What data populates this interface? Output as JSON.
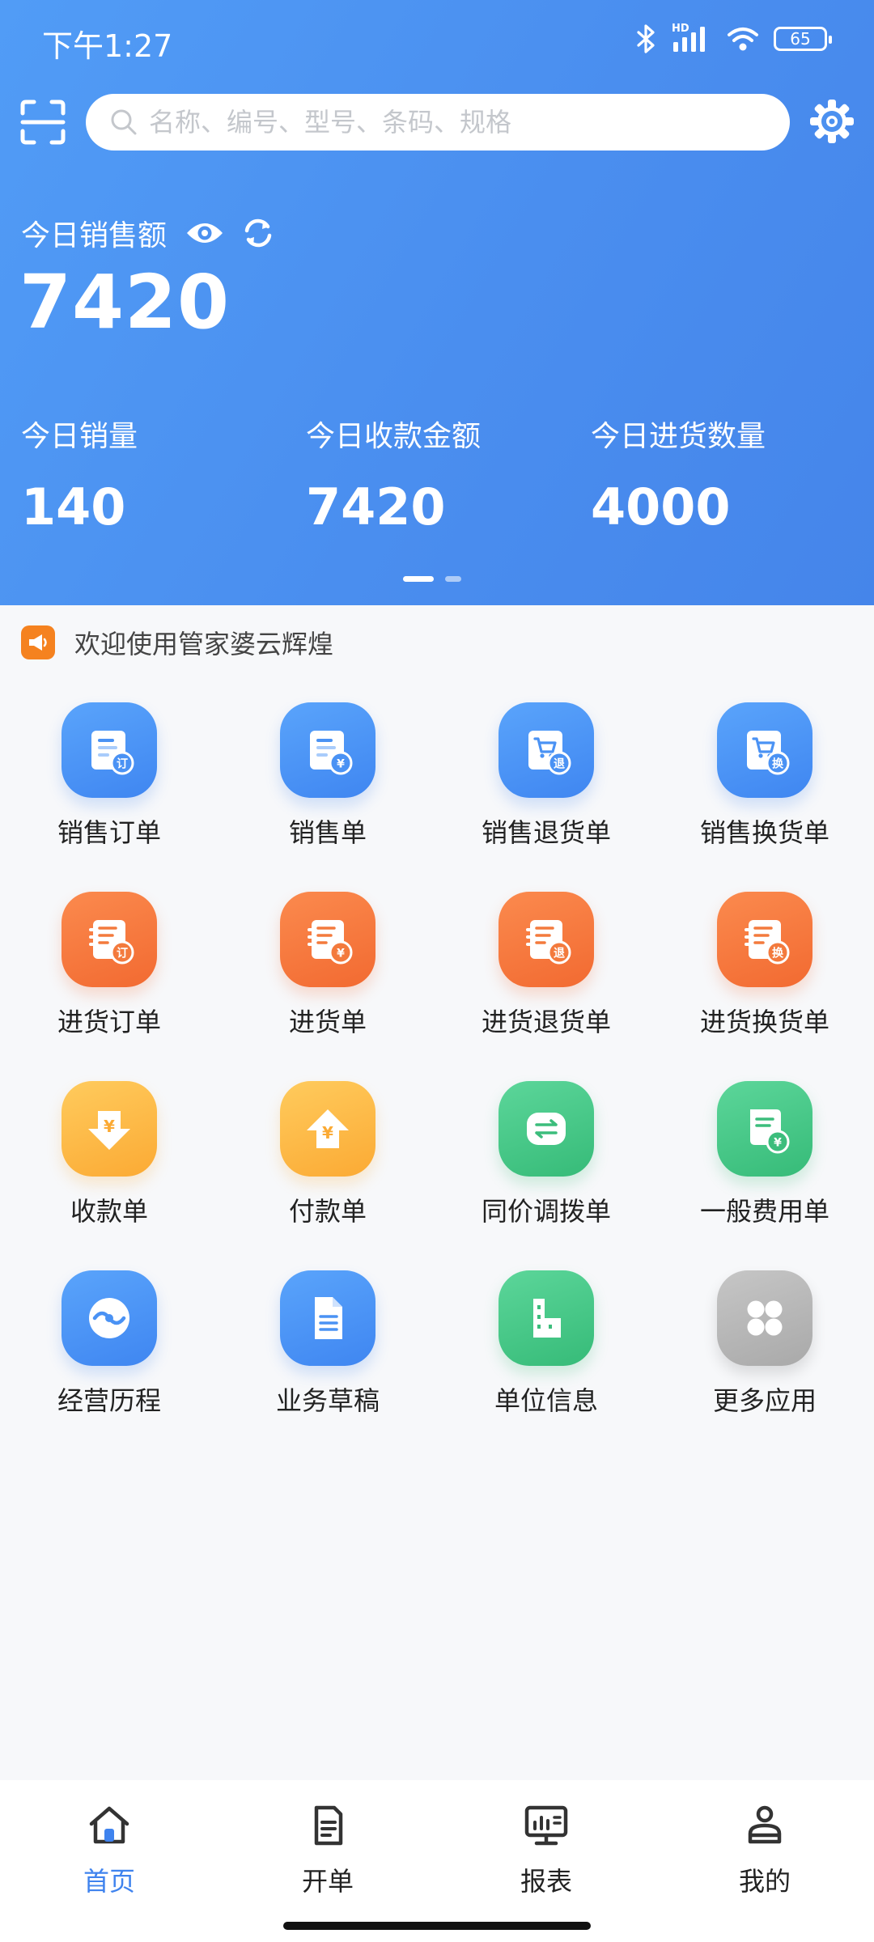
{
  "status_bar": {
    "time": "下午1:27",
    "hd": "HD",
    "battery": "65"
  },
  "search": {
    "placeholder": "名称、编号、型号、条码、规格"
  },
  "summary": {
    "sales_label": "今日销售额",
    "sales_value": "7420",
    "stats": [
      {
        "label": "今日销量",
        "value": "140"
      },
      {
        "label": "今日收款金额",
        "value": "7420"
      },
      {
        "label": "今日进货数量",
        "value": "4000"
      }
    ],
    "pager": {
      "current": 1,
      "total": 2
    }
  },
  "notice": {
    "text": "欢迎使用管家婆云辉煌"
  },
  "apps": [
    {
      "label": "销售订单",
      "icon": "sales-order-icon",
      "color": "blue",
      "badge": "订"
    },
    {
      "label": "销售单",
      "icon": "sales-bill-icon",
      "color": "blue",
      "badge": "¥"
    },
    {
      "label": "销售退货单",
      "icon": "sales-return-icon",
      "color": "blue",
      "badge": "退"
    },
    {
      "label": "销售换货单",
      "icon": "sales-exchange-icon",
      "color": "blue",
      "badge": "换"
    },
    {
      "label": "进货订单",
      "icon": "purchase-order-icon",
      "color": "orange",
      "badge": "订"
    },
    {
      "label": "进货单",
      "icon": "purchase-bill-icon",
      "color": "orange",
      "badge": "¥"
    },
    {
      "label": "进货退货单",
      "icon": "purchase-return-icon",
      "color": "orange",
      "badge": "退"
    },
    {
      "label": "进货换货单",
      "icon": "purchase-exchange-icon",
      "color": "orange",
      "badge": "换"
    },
    {
      "label": "收款单",
      "icon": "receipt-icon",
      "color": "yellow",
      "badge": "¥"
    },
    {
      "label": "付款单",
      "icon": "payment-icon",
      "color": "yellow",
      "badge": "¥"
    },
    {
      "label": "同价调拨单",
      "icon": "transfer-icon",
      "color": "green",
      "badge": ""
    },
    {
      "label": "一般费用单",
      "icon": "expense-icon",
      "color": "green",
      "badge": "¥"
    },
    {
      "label": "经营历程",
      "icon": "history-icon",
      "color": "blue",
      "badge": ""
    },
    {
      "label": "业务草稿",
      "icon": "draft-icon",
      "color": "blue",
      "badge": ""
    },
    {
      "label": "单位信息",
      "icon": "unit-info-icon",
      "color": "green",
      "badge": ""
    },
    {
      "label": "更多应用",
      "icon": "more-apps-icon",
      "color": "gray",
      "badge": ""
    }
  ],
  "tabs": [
    {
      "label": "首页",
      "icon": "home-icon",
      "active": true
    },
    {
      "label": "开单",
      "icon": "document-icon",
      "active": false
    },
    {
      "label": "报表",
      "icon": "report-icon",
      "active": false
    },
    {
      "label": "我的",
      "icon": "profile-icon",
      "active": false
    }
  ],
  "colors": {
    "hero": "#4a8eef",
    "active_tab": "#3f83ee",
    "notice_icon": "#f5821f"
  }
}
